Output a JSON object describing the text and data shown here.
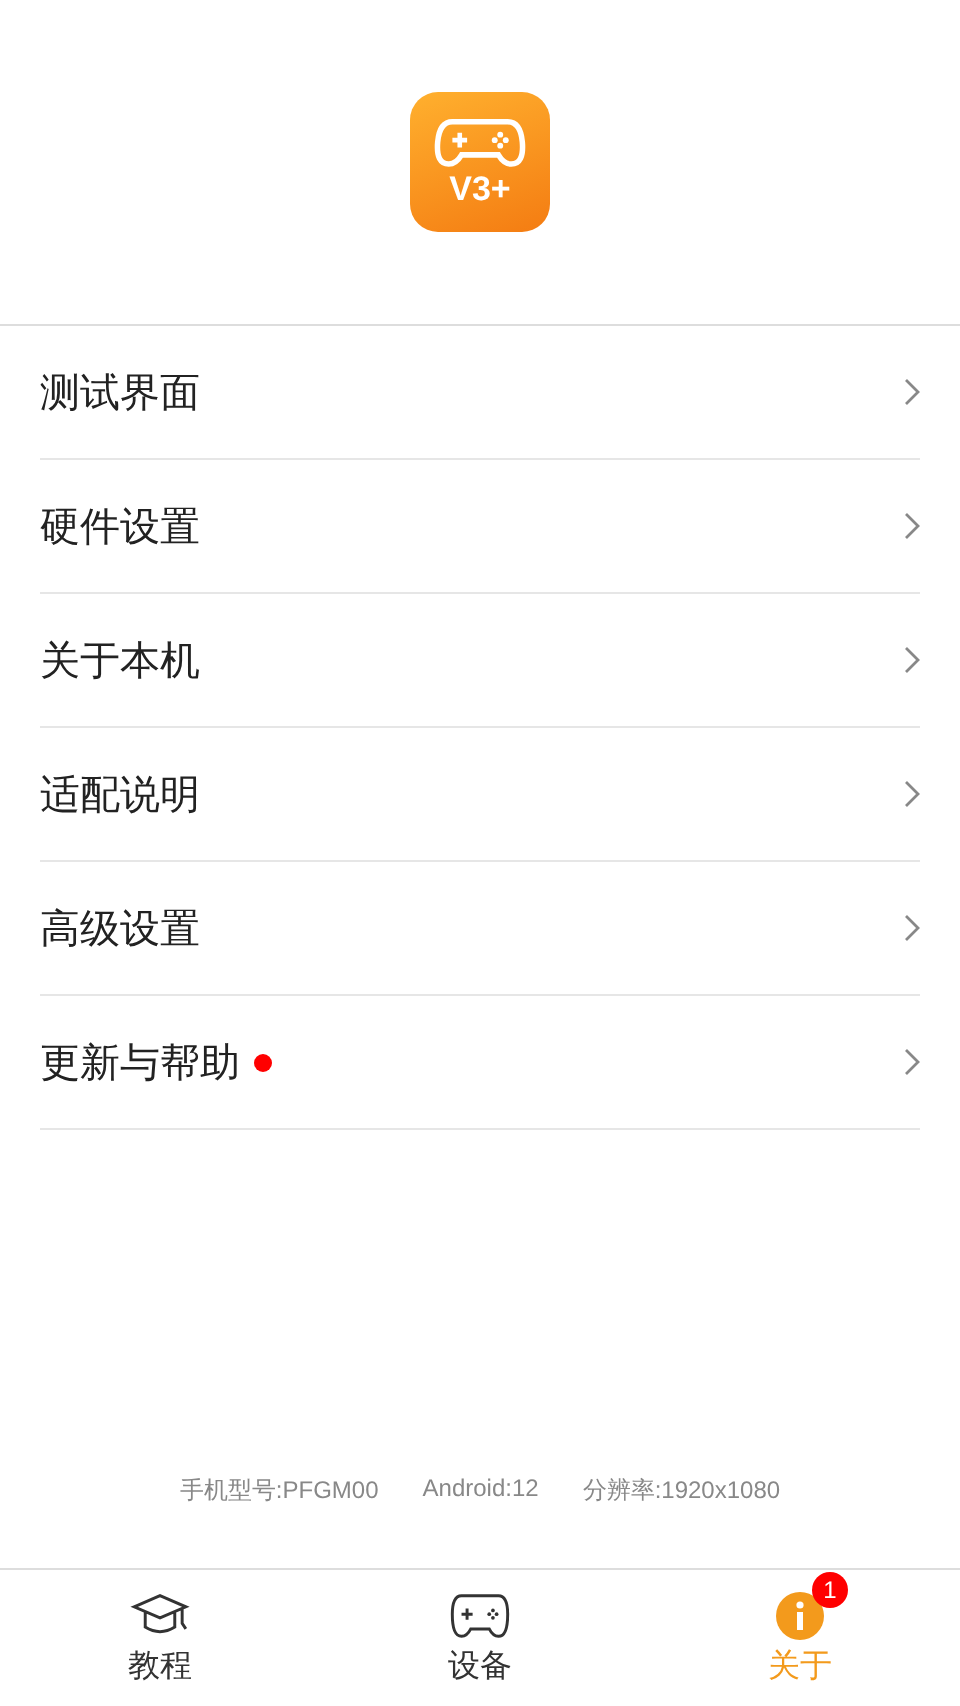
{
  "logo": {
    "text": "V3+"
  },
  "menu": [
    {
      "label": "测试界面",
      "dot": false
    },
    {
      "label": "硬件设置",
      "dot": false
    },
    {
      "label": "关于本机",
      "dot": false
    },
    {
      "label": "适配说明",
      "dot": false
    },
    {
      "label": "高级设置",
      "dot": false
    },
    {
      "label": "更新与帮助",
      "dot": true
    }
  ],
  "device_info": [
    "手机型号:PFGM00",
    "Android:12",
    "分辨率:1920x1080"
  ],
  "tabs": [
    {
      "kind": "tutorial",
      "label": "教程",
      "selected": false
    },
    {
      "kind": "device",
      "label": "设备",
      "selected": false
    },
    {
      "kind": "about",
      "label": "关于",
      "selected": true,
      "badge": "1"
    }
  ]
}
